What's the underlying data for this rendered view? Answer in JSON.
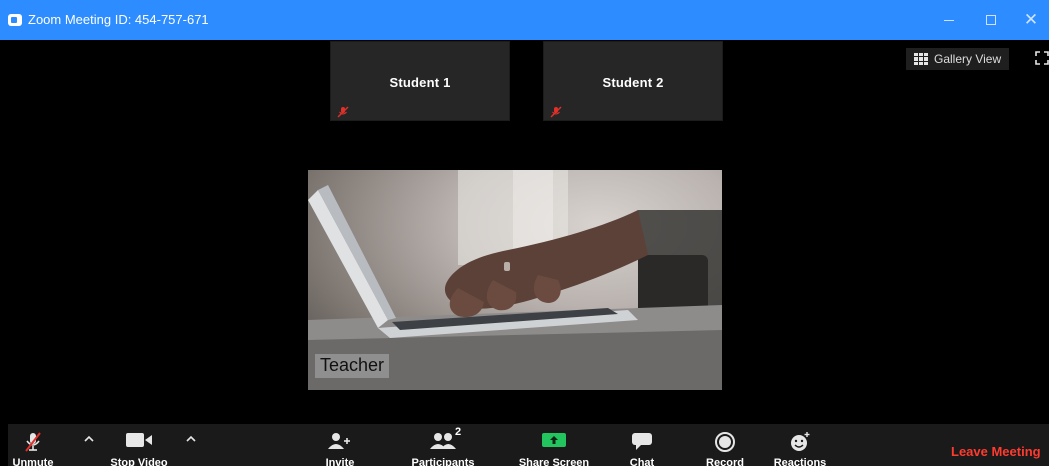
{
  "window": {
    "title": "Zoom Meeting ID: 454-757-671",
    "minimize_glyph": "—",
    "maximize_glyph": "□",
    "close_glyph": "✕"
  },
  "top_right": {
    "gallery_view_label": "Gallery View",
    "gallery_icon": "grid-icon",
    "fullscreen_icon": "fullscreen-icon"
  },
  "participants": [
    {
      "name": "Student 1",
      "muted": true
    },
    {
      "name": "Student 2",
      "muted": true
    }
  ],
  "active_speaker": {
    "name": "Teacher",
    "video": "hands-typing-on-laptop"
  },
  "toolbar": {
    "unmute_label": "Unmute",
    "stop_video_label": "Stop Video",
    "invite_label": "Invite",
    "participants_label": "Participants",
    "participants_count": "2",
    "share_screen_label": "Share Screen",
    "chat_label": "Chat",
    "record_label": "Record",
    "reactions_label": "Reactions",
    "leave_label": "Leave Meeting"
  },
  "colors": {
    "titlebar": "#2d8cff",
    "mute_red": "#e0302a",
    "share_green": "#22c55e",
    "leave_red": "#ff3b30"
  }
}
